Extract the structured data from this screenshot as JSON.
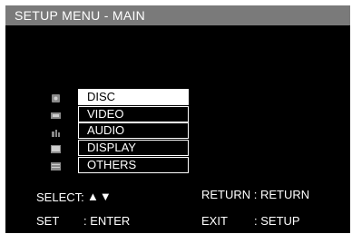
{
  "header": {
    "title": "SETUP MENU - MAIN"
  },
  "menu": {
    "items": [
      {
        "label": "DISC",
        "icon": "disc-icon",
        "selected": true
      },
      {
        "label": "VIDEO",
        "icon": "video-icon",
        "selected": false
      },
      {
        "label": "AUDIO",
        "icon": "audio-icon",
        "selected": false
      },
      {
        "label": "DISPLAY",
        "icon": "display-icon",
        "selected": false
      },
      {
        "label": "OTHERS",
        "icon": "others-icon",
        "selected": false
      }
    ]
  },
  "footer": {
    "select_label": "SELECT:",
    "select_arrows": "▲▼",
    "return_hint": "RETURN : RETURN",
    "set_label": "SET",
    "set_value": ": ENTER",
    "exit_label": "EXIT",
    "exit_value": ": SETUP"
  },
  "colors": {
    "background": "#000000",
    "titlebar": "#7a7a7a",
    "text": "#ffffff",
    "selected_bg": "#ffffff",
    "selected_text": "#000000"
  }
}
